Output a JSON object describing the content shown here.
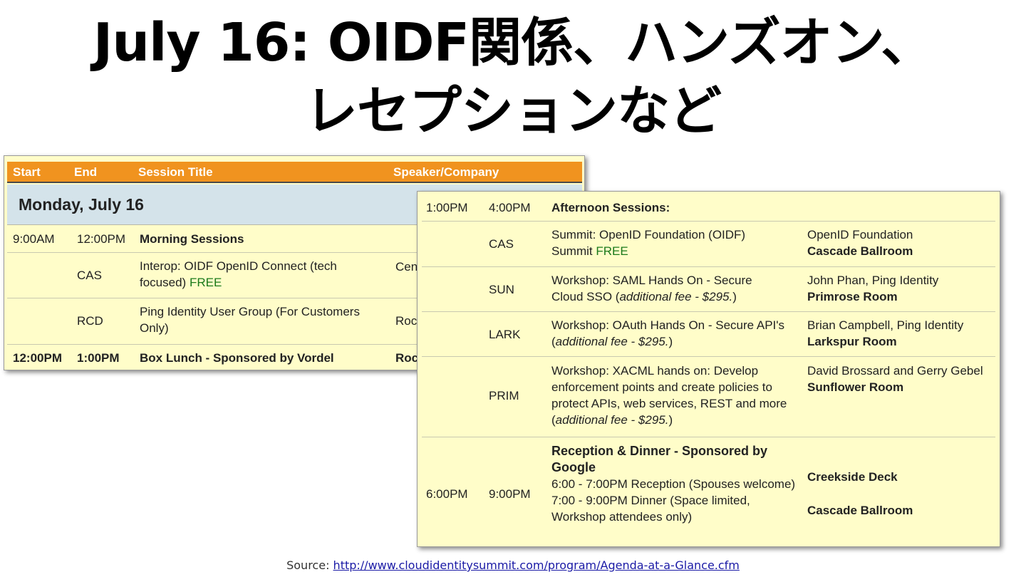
{
  "title": {
    "line1": "July 16: OIDF関係、ハンズオン、",
    "line2": "レセプションなど"
  },
  "left_table": {
    "headers": [
      "Start",
      "End",
      "Session Title",
      "Speaker/Company"
    ],
    "day": "Monday, July 16",
    "rows": [
      {
        "start": "9:00AM",
        "end": "12:00PM",
        "title": "Morning Sessions",
        "speaker": ""
      },
      {
        "start": "",
        "end": "CAS",
        "title": "Interop: OIDF OpenID Connect (tech focused)",
        "free": "FREE",
        "speaker": "Cen"
      },
      {
        "start": "",
        "end": "RCD",
        "title": "Ping Identity User Group (For Customers Only)",
        "speaker": "Roc"
      },
      {
        "start": "12:00PM",
        "end": "1:00PM",
        "title": "Box Lunch - Sponsored by Vordel",
        "speaker": "Roc"
      }
    ]
  },
  "right_table": {
    "rows": [
      {
        "start": "1:00PM",
        "end": "4:00PM",
        "title": "Afternoon Sessions:"
      },
      {
        "room": "CAS",
        "title": "Summit:  OpenID Foundation (OIDF) Summit",
        "free": "FREE",
        "speaker": "OpenID Foundation",
        "location": "Cascade Ballroom"
      },
      {
        "room": "SUN",
        "title": "Workshop: SAML Hands On - Secure Cloud SSO",
        "fee": "additional fee - $295.",
        "speaker": "John Phan, Ping Identity",
        "location": "Primrose Room"
      },
      {
        "room": "LARK",
        "title": "Workshop: OAuth Hands On - Secure API's",
        "fee": "additional fee - $295.",
        "speaker": "Brian Campbell, Ping Identity",
        "location": "Larkspur Room"
      },
      {
        "room": "PRIM",
        "title": "Workshop: XACML hands on: Develop enforcement points and create policies to protect APIs, web services, REST and more",
        "fee": "additional fee - $295.",
        "speaker": "David Brossard and Gerry Gebel",
        "location": "Sunflower Room"
      },
      {
        "start": "6:00PM",
        "end": "9:00PM",
        "title": "Reception & Dinner - Sponsored by Google",
        "line1": "6:00 - 7:00PM Reception (Spouses welcome)",
        "line2": "7:00 - 9:00PM Dinner (Space limited, Workshop attendees only)",
        "loc1": "Creekside Deck",
        "loc2": "Cascade Ballroom"
      }
    ]
  },
  "source": {
    "label": "Source:",
    "url": "http://www.cloudidentitysummit.com/program/Agenda-at-a-Glance.cfm"
  }
}
